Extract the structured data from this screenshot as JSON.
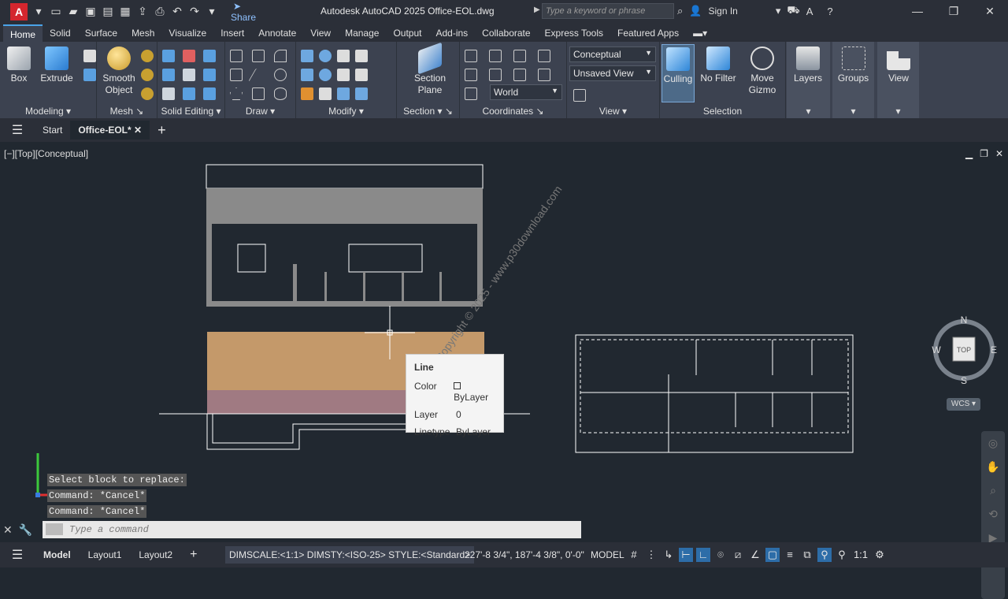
{
  "titlebar": {
    "app_letter": "A",
    "share": "Share",
    "title": "Autodesk AutoCAD 2025   Office-EOL.dwg",
    "search_placeholder": "Type a keyword or phrase",
    "sign_in": "Sign In"
  },
  "ribbon_tabs": [
    "Home",
    "Solid",
    "Surface",
    "Mesh",
    "Visualize",
    "Insert",
    "Annotate",
    "View",
    "Manage",
    "Output",
    "Add-ins",
    "Collaborate",
    "Express Tools",
    "Featured Apps"
  ],
  "ribbon": {
    "box": "Box",
    "extrude": "Extrude",
    "smooth_object": "Smooth Object",
    "section_plane": "Section Plane",
    "culling": "Culling",
    "no_filter": "No Filter",
    "move_gizmo": "Move Gizmo",
    "layers": "Layers",
    "groups": "Groups",
    "view": "View",
    "visual_style": "Conceptual",
    "named_view": "Unsaved View",
    "ucs": "World",
    "panels": [
      "Modeling",
      "Mesh",
      "Solid Editing",
      "Draw",
      "Modify",
      "Section",
      "Coordinates",
      "View",
      "Selection"
    ]
  },
  "file_tabs": {
    "start": "Start",
    "current": "Office-EOL*"
  },
  "viewport": {
    "label": "[−][Top][Conceptual]",
    "compass": {
      "n": "N",
      "s": "S",
      "e": "E",
      "w": "W",
      "top": "TOP"
    },
    "wcs": "WCS",
    "watermark": "Copyright © 2025 - www.p30download.com"
  },
  "tooltip": {
    "title": "Line",
    "rows": [
      {
        "k": "Color",
        "v": "ByLayer"
      },
      {
        "k": "Layer",
        "v": "0"
      },
      {
        "k": "Linetype",
        "v": "ByLayer"
      }
    ]
  },
  "command": {
    "history": [
      "Select block to replace:",
      "Command: *Cancel*",
      "Command: *Cancel*"
    ],
    "placeholder": "Type a command"
  },
  "statusbar": {
    "model_tab": "Model",
    "layout1": "Layout1",
    "layout2": "Layout2",
    "info": "DIMSCALE:<1:1> DIMSTY:<ISO-25> STYLE:<Standard>",
    "coords": "227'-8 3/4\", 187'-4 3/8\", 0'-0\"",
    "model": "MODEL",
    "scale": "1:1"
  }
}
